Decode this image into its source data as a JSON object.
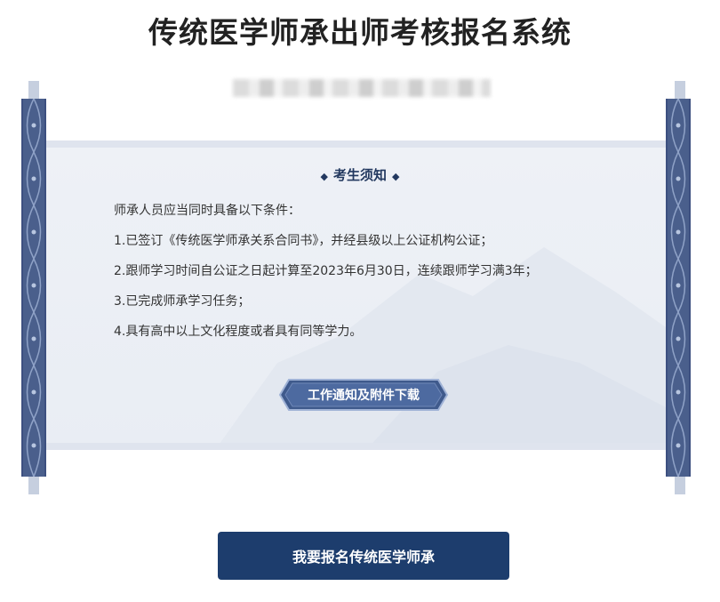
{
  "page": {
    "title": "传统医学师承出师考核报名系统"
  },
  "notice": {
    "heading": "考生须知",
    "lines": [
      "师承人员应当同时具备以下条件：",
      "1.已签订《传统医学师承关系合同书》，并经县级以上公证机构公证；",
      "2.跟师学习时间自公证之日起计算至2023年6月30日，连续跟师学习满3年；",
      "3.已完成师承学习任务；",
      "4.具有高中以上文化程度或者具有同等学力。"
    ],
    "download_label": "工作通知及附件下载"
  },
  "actions": {
    "apply_label": "我要报名传统医学师承"
  },
  "colors": {
    "primary": "#1d3d6d",
    "scroll_rod": "#4a5f8c",
    "paper": "#eef1f6"
  }
}
